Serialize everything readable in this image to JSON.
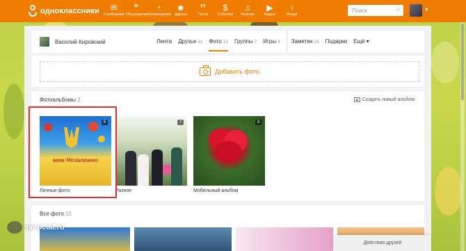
{
  "header": {
    "logo_text": "одноклассники",
    "nav": [
      {
        "label": "Сообщения",
        "icon": "envelope-icon",
        "glyph": "✉"
      },
      {
        "label": "Обсуждения",
        "icon": "chat-icon",
        "glyph": "💬"
      },
      {
        "label": "Оповещения",
        "icon": "bell-icon",
        "glyph": "🔔"
      },
      {
        "label": "Друзья",
        "icon": "friends-icon",
        "glyph": "👥"
      },
      {
        "label": "Гости",
        "icon": "footprints-icon",
        "glyph": "👣"
      },
      {
        "label": "События",
        "icon": "events-icon",
        "glyph": "$"
      },
      {
        "label": "Музыка",
        "icon": "music-icon",
        "glyph": "♫"
      },
      {
        "label": "Видео",
        "icon": "video-icon",
        "glyph": "▶"
      },
      {
        "label": "Везде",
        "icon": "ok-icon",
        "glyph": "ꝏ"
      }
    ],
    "search_placeholder": "Поиск",
    "brand_color": "#f07d00"
  },
  "profile": {
    "name": "Василий Кировский",
    "tabs": [
      {
        "label": "Лента",
        "count": ""
      },
      {
        "label": "Друзья",
        "count": "31"
      },
      {
        "label": "Фото",
        "count": "15",
        "active": true
      },
      {
        "label": "Группы",
        "count": "7"
      },
      {
        "label": "Игры",
        "count": "4"
      },
      {
        "label": "Заметки",
        "count": "25"
      },
      {
        "label": "Подарки",
        "count": ""
      },
      {
        "label": "Ещё ▾",
        "count": ""
      }
    ]
  },
  "add_photo": {
    "label": "Добавить фото"
  },
  "albums": {
    "title": "Фотоальбомы",
    "count": "3",
    "create_label": "Создать новый альбом",
    "items": [
      {
        "label": "Личные фото",
        "count": "5",
        "banner": "мем Незалежно"
      },
      {
        "label": "Разное",
        "count": "7"
      },
      {
        "label": "Мобильный альбом",
        "count": "3"
      }
    ]
  },
  "all_photos": {
    "title": "Все фото",
    "count": "15"
  },
  "friends_actions": "Действия друзей",
  "watermark": "sysocial.ru"
}
